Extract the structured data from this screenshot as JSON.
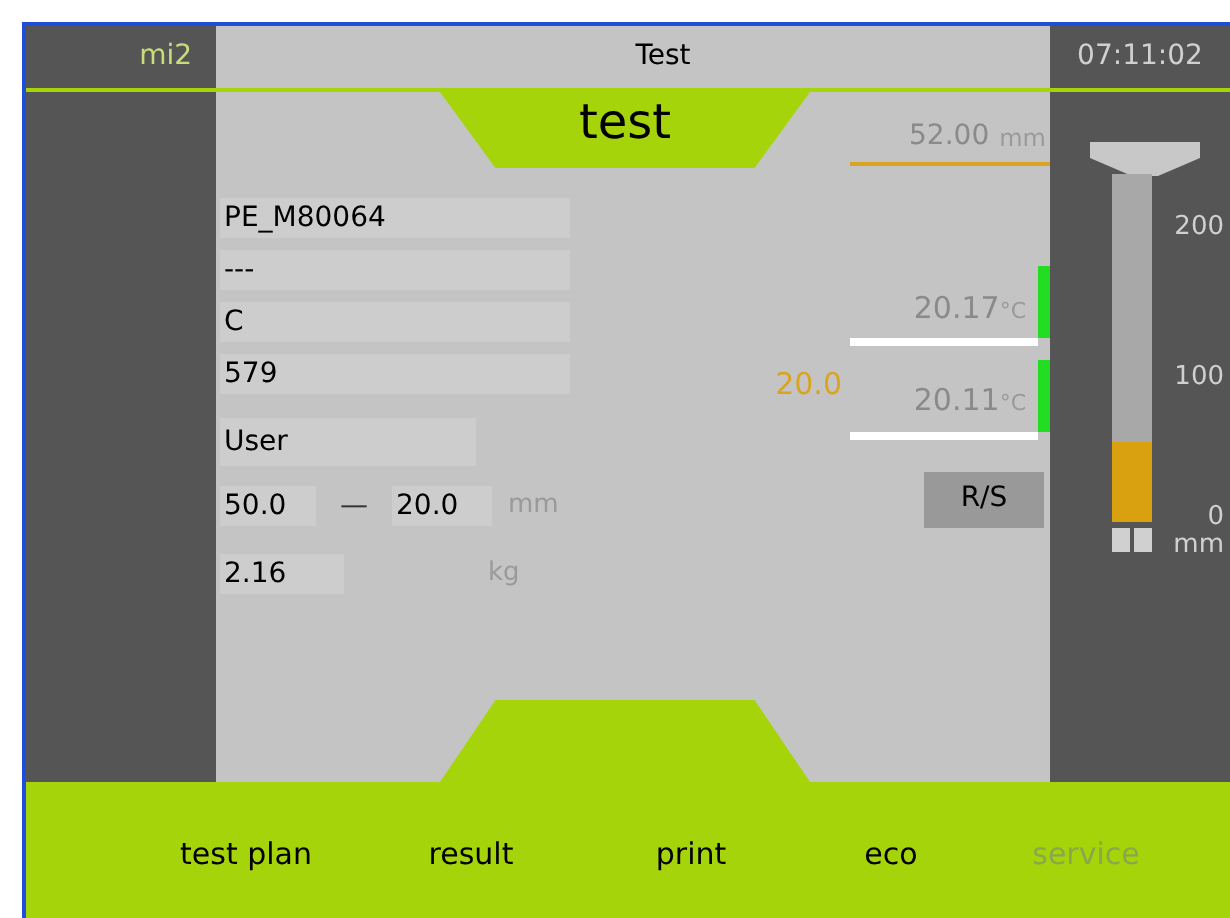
{
  "header": {
    "left": "mi2",
    "title": "Test",
    "time": "07:11:02"
  },
  "program": "test",
  "length": {
    "value": "52.00",
    "unit": "mm"
  },
  "fields": [
    "PE_M80064",
    "---",
    "C",
    "579"
  ],
  "user": "User",
  "range": {
    "from": "50.0",
    "separator": "—",
    "to": "20.0",
    "unit": "mm"
  },
  "weight": {
    "value": "2.16",
    "unit": "kg"
  },
  "setpoint": "20.0",
  "temperatures": [
    {
      "value": "20.17",
      "unit": "°C"
    },
    {
      "value": "20.11",
      "unit": "°C"
    }
  ],
  "rs_button": "R/S",
  "gauge": {
    "level": 0.23,
    "ticks": [
      "200",
      "100",
      "0"
    ],
    "unit": "mm"
  },
  "tabs": [
    {
      "label": "test plan",
      "disabled": false
    },
    {
      "label": "result",
      "disabled": false
    },
    {
      "label": "print",
      "disabled": false
    },
    {
      "label": "eco",
      "disabled": false
    },
    {
      "label": "service",
      "disabled": true
    }
  ]
}
